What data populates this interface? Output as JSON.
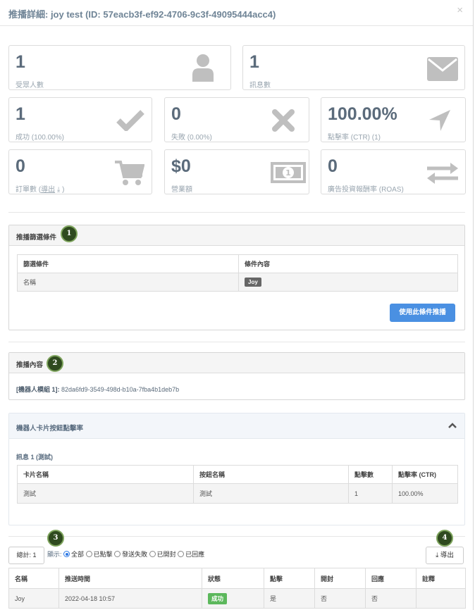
{
  "modal": {
    "title": "推播詳細: joy test (ID: 57eacb3f-ef92-4706-9c3f-49095444acc4)",
    "close": "×"
  },
  "stats": {
    "audience": {
      "value": "1",
      "label": "受眾人數",
      "icon": "user-icon"
    },
    "messages": {
      "value": "1",
      "label": "訊息數",
      "icon": "envelope-icon"
    },
    "success": {
      "value": "1",
      "label": "成功 (100.00%)",
      "icon": "check-icon"
    },
    "failed": {
      "value": "0",
      "label": "失敗 (0.00%)",
      "icon": "x-icon"
    },
    "ctr": {
      "value": "100.00%",
      "label": "點擊率 (CTR) (1)",
      "icon": "location-arrow-icon"
    },
    "orders": {
      "value": "0",
      "label_prefix": "訂單數 (",
      "export_link": "導出",
      "label_suffix": ")",
      "icon": "cart-icon"
    },
    "revenue": {
      "value": "$0",
      "label": "營業額",
      "icon": "money-icon"
    },
    "roas": {
      "value": "0",
      "label": "廣告投資報酬率 (ROAS)",
      "icon": "exchange-icon"
    }
  },
  "filters": {
    "title": "推播篩選條件",
    "badge": "1",
    "headers": [
      "篩選條件",
      "條件內容"
    ],
    "rows": [
      {
        "condition": "名稱",
        "content": "Joy"
      }
    ],
    "use_button": "使用此條件推播"
  },
  "content": {
    "title": "推播內容",
    "badge": "2",
    "module_label": "[機器人模組 1]:",
    "module_id": "82da6fd9-3549-498d-b10a-7fba4b1deb7b"
  },
  "ctr_panel": {
    "title": "機器人卡片按鈕點擊率",
    "message_title": "訊息 1 (測試)",
    "headers": [
      "卡片名稱",
      "按鈕名稱",
      "點擊數",
      "點擊率 (CTR)"
    ],
    "rows": [
      {
        "card": "測試",
        "button": "測試",
        "clicks": "1",
        "ctr": "100.00%"
      }
    ]
  },
  "list": {
    "total": "總計: 1",
    "badge3": "3",
    "badge4": "4",
    "show_label": "顯示:",
    "filters": [
      "全部",
      "已點擊",
      "發送失敗",
      "已開封",
      "已回應"
    ],
    "selected": "全部",
    "export_button": "導出",
    "headers": [
      "名稱",
      "推送時間",
      "狀態",
      "點擊",
      "開封",
      "回應",
      "註釋"
    ],
    "rows": [
      {
        "name": "Joy",
        "time": "2022-04-18 10:57",
        "status": "成功",
        "click": "是",
        "open": "否",
        "reply": "否",
        "note": ""
      }
    ]
  },
  "colors": {
    "accent": "#4a90e2",
    "stat_value": "#5b6b7b",
    "icon_grey": "#bfbfbf",
    "success": "#5cb85c",
    "badge": "#2f4a1f"
  }
}
